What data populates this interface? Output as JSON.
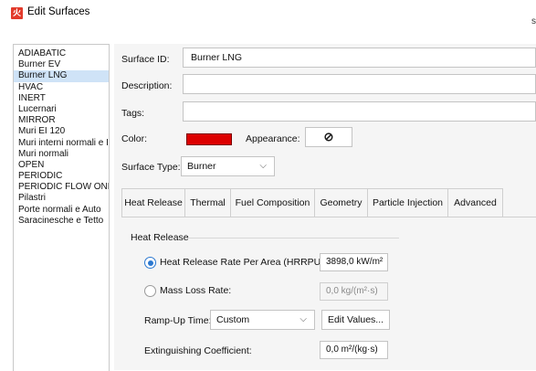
{
  "window": {
    "title": "Edit Surfaces",
    "app_icon_glyph": "火"
  },
  "top_right_mark": "s",
  "surfaces": [
    {
      "label": "ADIABATIC",
      "selected": false
    },
    {
      "label": "Burner EV",
      "selected": false
    },
    {
      "label": "Burner LNG",
      "selected": true
    },
    {
      "label": "HVAC",
      "selected": false
    },
    {
      "label": "INERT",
      "selected": false
    },
    {
      "label": "Lucernari",
      "selected": false
    },
    {
      "label": "MIRROR",
      "selected": false
    },
    {
      "label": "Muri EI 120",
      "selected": false
    },
    {
      "label": "Muri interni normali e I",
      "selected": false
    },
    {
      "label": "Muri normali",
      "selected": false
    },
    {
      "label": "OPEN",
      "selected": false
    },
    {
      "label": "PERIODIC",
      "selected": false
    },
    {
      "label": "PERIODIC FLOW ONL",
      "selected": false
    },
    {
      "label": "Pilastri",
      "selected": false
    },
    {
      "label": "Porte normali e Auto",
      "selected": false
    },
    {
      "label": "Saracinesche e Tetto",
      "selected": false
    }
  ],
  "form": {
    "surface_id_label": "Surface ID:",
    "surface_id_value": "Burner LNG",
    "description_label": "Description:",
    "description_value": "",
    "tags_label": "Tags:",
    "tags_value": "",
    "color_label": "Color:",
    "color_value": "#dd0000",
    "appearance_label": "Appearance:",
    "appearance_glyph": "⊘",
    "surface_type_label": "Surface Type:",
    "surface_type_value": "Burner"
  },
  "tabs": [
    {
      "label": "Heat Release",
      "active": true
    },
    {
      "label": "Thermal",
      "active": false
    },
    {
      "label": "Fuel Composition",
      "active": false
    },
    {
      "label": "Geometry",
      "active": false
    },
    {
      "label": "Particle Injection",
      "active": false
    },
    {
      "label": "Advanced",
      "active": false
    }
  ],
  "heat_release": {
    "group_title": "Heat Release",
    "hrrpua_label": "Heat Release Rate Per Area (HRRPUA):",
    "hrrpua_value": "3898,0 kW/m²",
    "hrrpua_selected": true,
    "mass_loss_label": "Mass Loss Rate:",
    "mass_loss_value": "0,0 kg/(m²·s)",
    "mass_loss_selected": false,
    "ramp_up_label": "Ramp-Up Time:",
    "ramp_up_value": "Custom",
    "edit_values_label": "Edit Values...",
    "extinguishing_label": "Extinguishing Coefficient:",
    "extinguishing_value": "0,0 m²/(kg·s)"
  },
  "colors": {
    "selection": "#cfe3f7",
    "radio_accent": "#2b78d0",
    "swatch": "#dd0000"
  }
}
